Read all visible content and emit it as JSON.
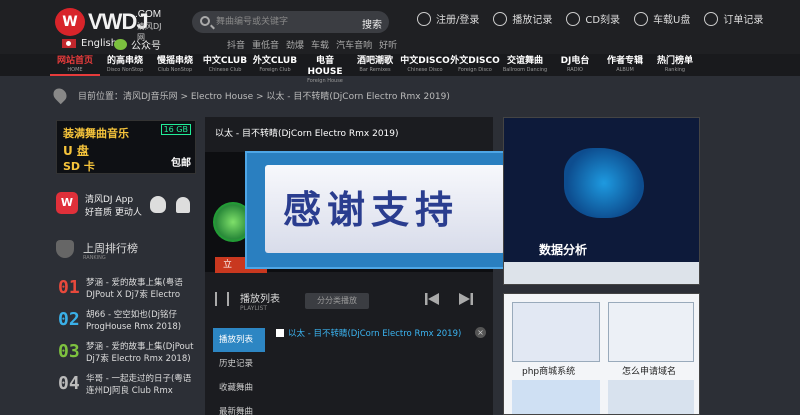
{
  "header": {
    "logo_text": "VWDJ",
    "logo_com": ".COM",
    "logo_cn": "清风DJ网",
    "lang": "English",
    "wechat": "公众号",
    "search_placeholder": "舞曲编号或关键字",
    "search_button": "搜索",
    "hotwords": [
      "抖音",
      "重低音",
      "劲爆",
      "车载",
      "汽车音响",
      "好听"
    ],
    "user_links": [
      "注册/登录",
      "播放记录",
      "CD刻录",
      "车载U盘",
      "订单记录"
    ]
  },
  "nav": [
    {
      "cn": "网站首页",
      "en": "HOME"
    },
    {
      "cn": "的高串烧",
      "en": "Disco NonStop"
    },
    {
      "cn": "慢摇串烧",
      "en": "Club NonStop"
    },
    {
      "cn": "中文CLUB",
      "en": "Chinese Club"
    },
    {
      "cn": "外文CLUB",
      "en": "Foreign Club"
    },
    {
      "cn": "电音HOUSE",
      "en": "Foreign House"
    },
    {
      "cn": "酒吧潮歌",
      "en": "Bar Remixes"
    },
    {
      "cn": "中文DISCO",
      "en": "Chinese Disco"
    },
    {
      "cn": "外文DISCO",
      "en": "Foreign Disco"
    },
    {
      "cn": "交谊舞曲",
      "en": "Ballroom Dancing"
    },
    {
      "cn": "DJ电台",
      "en": "RADIO"
    },
    {
      "cn": "作者专辑",
      "en": "ALBUM"
    },
    {
      "cn": "热门榜单",
      "en": "Ranking"
    }
  ],
  "breadcrumb": "目前位置：清风DJ音乐网 > Electro House > 以太 - 目不转睛(DjCorn Electro Rmx 2019)",
  "left": {
    "ad_line1": "装满舞曲音乐",
    "ad_line2": "U 盘",
    "ad_line3": "SD 卡",
    "ad_gb": "16 GB",
    "ad_pack": "包邮",
    "app_name": "清风DJ App",
    "app_sub": "好音质  更动人",
    "rank_title": "上周排行榜",
    "rank_en": "RANKING",
    "rank_items": [
      {
        "num": "01",
        "color": "#e8493c",
        "text": "梦涵 - 爱的故事上集(粤语DJPout X Dj7索 Electro"
      },
      {
        "num": "02",
        "color": "#3ab0e8",
        "text": "胡66 - 空空如也(Dj铭仔 ProgHouse Rmx 2018)"
      },
      {
        "num": "03",
        "color": "#7ec23f",
        "text": "梦涵 - 爱的故事上集(DjPout Dj7索 Electro Rmx 2018)"
      },
      {
        "num": "04",
        "color": "#bbbbbb",
        "text": "华哥 - 一起走过的日子(粤语 连州DJ阿良 Club Rmx"
      }
    ]
  },
  "player": {
    "title": "以太 - 目不转睛(DjCorn Electro Rmx 2019)",
    "play_label": "立",
    "playlist_title": "播放列表",
    "playlist_en": "PLAYLIST",
    "shuffle": "分分类播放",
    "side_tabs": [
      "播放列表",
      "历史记录",
      "收藏舞曲",
      "最新舞曲"
    ],
    "track": "以太 - 目不转睛(DjCorn Electro Rmx 2019)",
    "close": "×"
  },
  "overlay_text": "感谢支持",
  "right": {
    "ad1_label": "数据分析",
    "cap_a": "php商城系统",
    "cap_b": "怎么申请域名"
  }
}
